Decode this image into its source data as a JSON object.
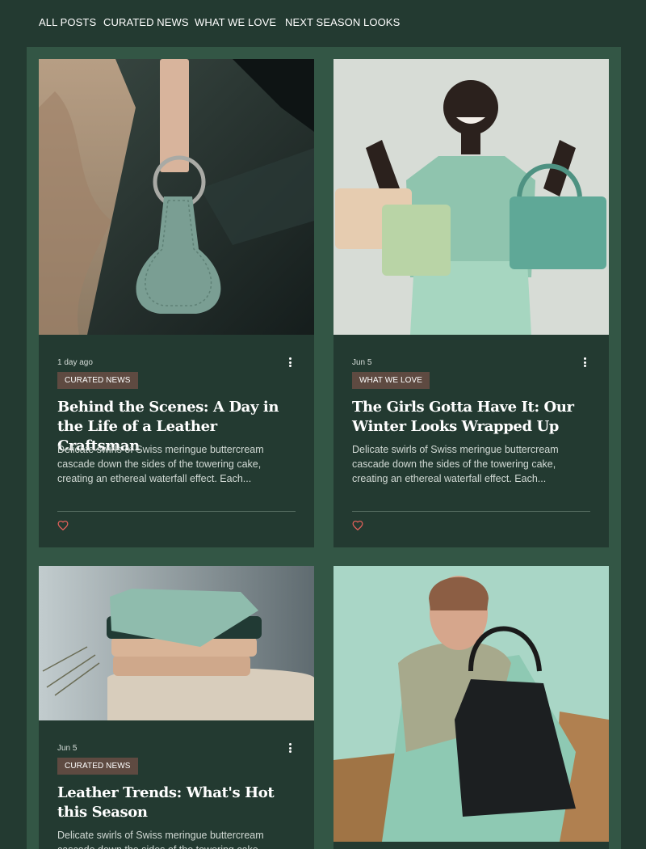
{
  "nav": {
    "items": [
      "ALL POSTS",
      "CURATED NEWS",
      "WHAT WE LOVE",
      "NEXT SEASON LOOKS"
    ]
  },
  "colors": {
    "page_bg": "#233a31",
    "panel_bg": "#335645",
    "badge_bg": "#5e4a41",
    "heart": "#e0605a"
  },
  "posts": [
    {
      "date": "1 day ago",
      "category": "CURATED NEWS",
      "title": "Behind the Scenes: A Day in the Life of a Leather Craftsman",
      "excerpt": "Delicate swirls of Swiss meringue buttercream cascade down the sides of the towering cake, creating an ethereal waterfall effect. Each...",
      "image": "leather-keychain-photo"
    },
    {
      "date": "Jun 5",
      "category": "WHAT WE LOVE",
      "title": "The Girls Gotta Have It: Our Winter Looks Wrapped Up",
      "excerpt": "Delicate swirls of Swiss meringue buttercream cascade down the sides of the towering cake, creating an ethereal waterfall effect. Each...",
      "image": "woman-with-handbags-photo"
    },
    {
      "date": "Jun 5",
      "category": "CURATED NEWS",
      "title": "Leather Trends: What's Hot this Season",
      "excerpt": "Delicate swirls of Swiss meringue buttercream cascade down the sides of the towering cake, creating an ethereal...",
      "image": "stacked-wallets-photo"
    },
    {
      "image": "woman-with-black-bag-photo"
    }
  ]
}
